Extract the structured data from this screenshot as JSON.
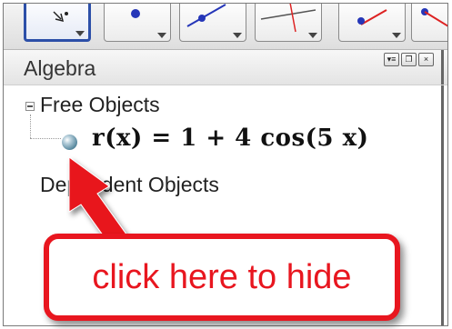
{
  "algebra_view": {
    "title": "Algebra",
    "header_buttons": [
      "sort-icon",
      "restore-icon",
      "close-icon"
    ],
    "tree": {
      "free_objects_label": "Free Objects",
      "dependent_objects_label": "Dependent Objects",
      "items": [
        {
          "visibility_icon": "visible-ball-icon",
          "definition": "r(x) = 1 + 4 cos(5 x)"
        }
      ]
    }
  },
  "toolbar": {
    "tools": [
      "move-tool-icon",
      "point-tool-icon",
      "line-tool-icon",
      "perpendicular-line-tool-icon",
      "circle-tool-icon",
      "angle-tool-icon"
    ]
  },
  "annotation": {
    "callout_text": "click here to hide",
    "color": "#e8161f"
  },
  "colors": {
    "tool_selected_border": "#2c4fa8",
    "annotation_red": "#e8161f"
  }
}
